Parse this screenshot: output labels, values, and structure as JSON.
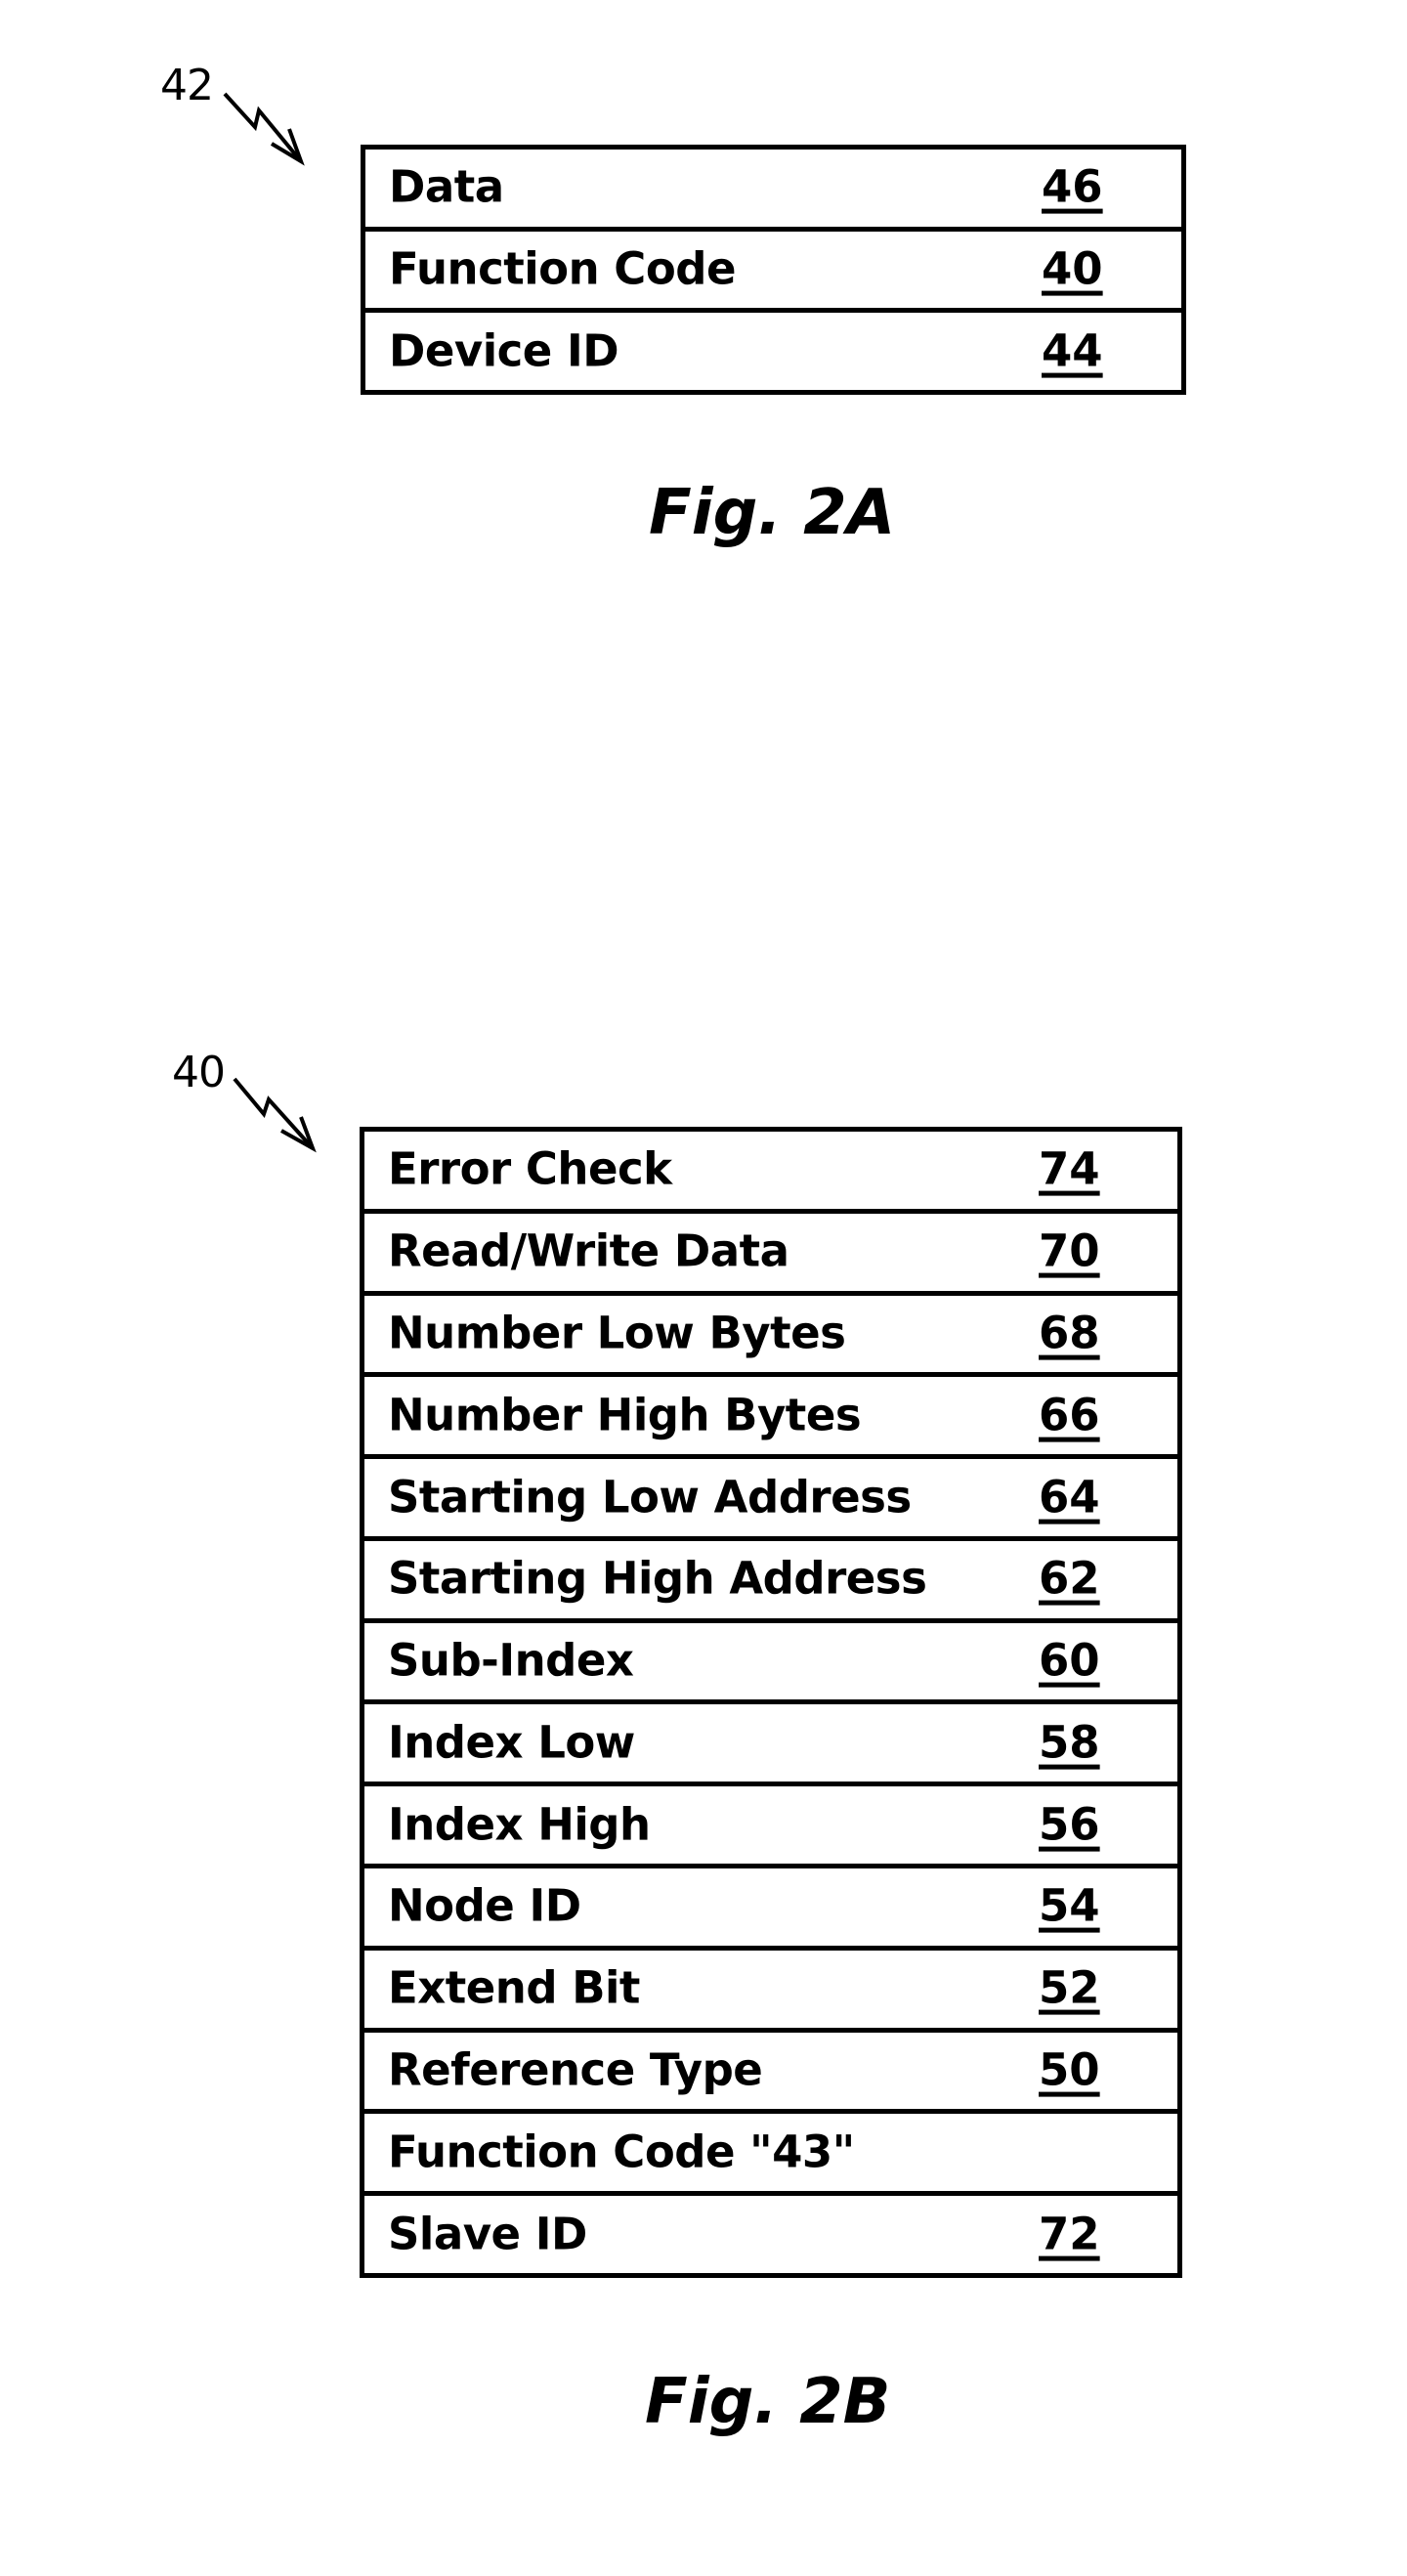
{
  "figures": [
    {
      "ref_label": "42",
      "caption": "Fig. 2A",
      "rows": [
        {
          "label": "Data",
          "ref": "46"
        },
        {
          "label": "Function Code",
          "ref": "40"
        },
        {
          "label": "Device ID",
          "ref": "44"
        }
      ]
    },
    {
      "ref_label": "40",
      "caption": "Fig. 2B",
      "rows": [
        {
          "label": "Error Check",
          "ref": "74"
        },
        {
          "label": "Read/Write Data",
          "ref": "70"
        },
        {
          "label": "Number Low Bytes",
          "ref": "68"
        },
        {
          "label": "Number High Bytes",
          "ref": "66"
        },
        {
          "label": "Starting Low Address",
          "ref": "64"
        },
        {
          "label": "Starting High Address",
          "ref": "62"
        },
        {
          "label": "Sub-Index",
          "ref": "60"
        },
        {
          "label": "Index Low",
          "ref": "58"
        },
        {
          "label": "Index High",
          "ref": "56"
        },
        {
          "label": "Node ID",
          "ref": "54"
        },
        {
          "label": "Extend Bit",
          "ref": "52"
        },
        {
          "label": "Reference Type",
          "ref": "50"
        },
        {
          "label": "Function Code \"43\"",
          "ref": ""
        },
        {
          "label": "Slave ID",
          "ref": "72"
        }
      ]
    }
  ]
}
